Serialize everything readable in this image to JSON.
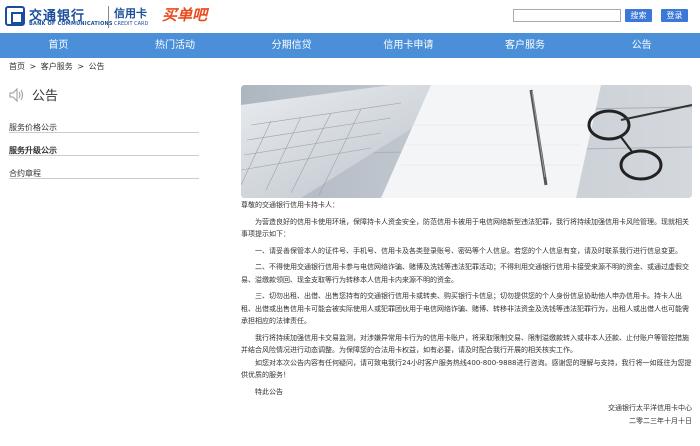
{
  "header": {
    "bank_cn": "交通银行",
    "bank_en": "BANK OF COMMUNICATIONS",
    "card_cn": "信用卡",
    "card_en": "CREDIT CARD",
    "brand": "买单吧",
    "search_placeholder": "",
    "search_label": "搜索",
    "login_label": "登录"
  },
  "nav": {
    "items": [
      "首页",
      "热门活动",
      "分期信贷",
      "信用卡申请",
      "客户服务",
      "公告"
    ]
  },
  "breadcrumb": {
    "home": "首页",
    "sep1": ">",
    "service": "客户服务",
    "sep2": ">",
    "current": "公告"
  },
  "sidebar": {
    "title": "公告",
    "items": [
      "服务价格公示",
      "服务升级公示",
      "合约章程"
    ]
  },
  "notice": {
    "greeting": "尊敬的交通银行信用卡持卡人：",
    "para1": "为营造良好的信用卡使用环境，保障持卡人资金安全，防范信用卡被用于电信网络新型违法犯罪，我行将持续加强信用卡风险管理。现就相关事项提示如下：",
    "para2": "一、请妥善保管本人的证件号、手机号、信用卡及各类登录账号、密码等个人信息。若您的个人信息有变，请及时联系我行进行信息变更。",
    "para3": "二、不得使用交通银行信用卡参与电信网络诈骗、赌博及洗钱等违法犯罪活动；不得利用交通银行信用卡接受来源不明的资金、或通过虚假交易、溢缴款领回、现金支取等行为转移本人信用卡内来源不明的资金。",
    "para4": "三、切勿出租、出借、出售您持有的交通银行信用卡或转卖、购买银行卡信息；切勿提供您的个人身份信息协助他人申办信用卡。持卡人出租、出借或出售信用卡可能会被实际使用人或犯罪团伙用于电信网络诈骗、赌博、转移非法资金及洗钱等违法犯罪行为，出租人或出借人也可能需承担相应的法律责任。",
    "para5": "我行将持续加强信用卡交易监测，对涉嫌异常用卡行为的信用卡账户，将采取限制交易、限制溢缴款转入或非本人还款、止付账户等管控措施并结合风险情况进行动态调整。为保障您的合法用卡权益，如有必要，请及时配合我行开展的相关核实工作。",
    "para6": "如您对本次公告内容有任何疑问，请可致电我行24小时客户服务热线400-800-9888进行咨询。感谢您的理解与支持，我行将一如既往为您提供优质的服务！",
    "closing": "特此公告",
    "signer": "交通银行太平洋信用卡中心",
    "date": "二零二三年十月十日"
  }
}
